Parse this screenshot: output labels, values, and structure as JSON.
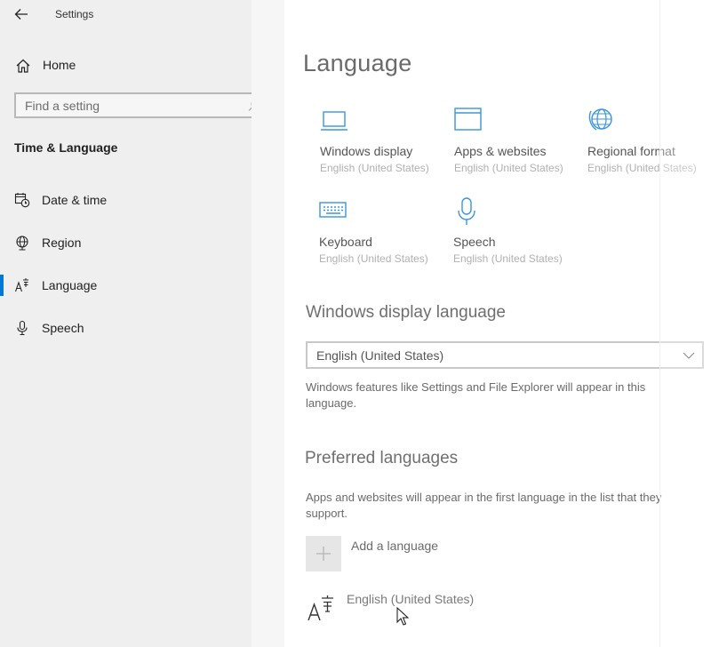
{
  "window": {
    "title": "Settings"
  },
  "sidebar": {
    "home_label": "Home",
    "search_placeholder": "Find a setting",
    "section_title": "Time & Language",
    "items": [
      {
        "label": "Date & time",
        "icon": "calendar-clock-icon"
      },
      {
        "label": "Region",
        "icon": "globe-icon"
      },
      {
        "label": "Language",
        "icon": "language-icon",
        "active": true
      },
      {
        "label": "Speech",
        "icon": "microphone-icon"
      }
    ]
  },
  "main": {
    "title": "Language",
    "tiles": [
      {
        "label": "Windows display",
        "sub": "English (United States)",
        "icon": "monitor-icon"
      },
      {
        "label": "Apps & websites",
        "sub": "English (United States)",
        "icon": "browser-window-icon"
      },
      {
        "label": "Regional format",
        "sub": "English (United States)",
        "icon": "globe-icon"
      },
      {
        "label": "Keyboard",
        "sub": "English (United States)",
        "icon": "keyboard-icon"
      },
      {
        "label": "Speech",
        "sub": "English (United States)",
        "icon": "microphone-icon"
      }
    ],
    "display_language": {
      "heading": "Windows display language",
      "selected": "English (United States)",
      "description": "Windows features like Settings and File Explorer will appear in this language."
    },
    "preferred": {
      "heading": "Preferred languages",
      "description": "Apps and websites will appear in the first language in the list that they support.",
      "add_label": "Add a language",
      "languages": [
        {
          "label": "English (United States)"
        }
      ]
    }
  },
  "colors": {
    "accent": "#0078d7",
    "sidebar_bg": "#efefef"
  }
}
